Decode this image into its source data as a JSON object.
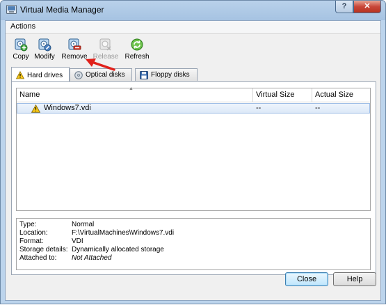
{
  "window": {
    "title": "Virtual Media Manager",
    "help_label": "?",
    "close_label": "✕"
  },
  "menu": {
    "actions_label": "Actions"
  },
  "toolbar": {
    "copy_label": "Copy",
    "modify_label": "Modify",
    "remove_label": "Remove",
    "release_label": "Release",
    "refresh_label": "Refresh"
  },
  "tabs": [
    {
      "label": "Hard drives",
      "active": true
    },
    {
      "label": "Optical disks",
      "active": false
    },
    {
      "label": "Floppy disks",
      "active": false
    }
  ],
  "table": {
    "columns": [
      "Name",
      "Virtual Size",
      "Actual Size"
    ],
    "rows": [
      {
        "name": "Windows7.vdi",
        "virtual_size": "--",
        "actual_size": "--",
        "selected": true
      }
    ]
  },
  "details": [
    {
      "key": "Type:",
      "value": "Normal"
    },
    {
      "key": "Location:",
      "value": "F:\\VirtualMachines\\Windows7.vdi"
    },
    {
      "key": "Format:",
      "value": "VDI"
    },
    {
      "key": "Storage details:",
      "value": "Dynamically allocated storage"
    },
    {
      "key": "Attached to:",
      "value": "Not Attached"
    }
  ],
  "buttons": {
    "close_label": "Close",
    "help_label": "Help"
  },
  "colors": {
    "title_gradient_top": "#b9d1ea",
    "selection": "#dce9f8",
    "close_button": "#c8473a",
    "annotation_arrow": "#e0211b"
  }
}
